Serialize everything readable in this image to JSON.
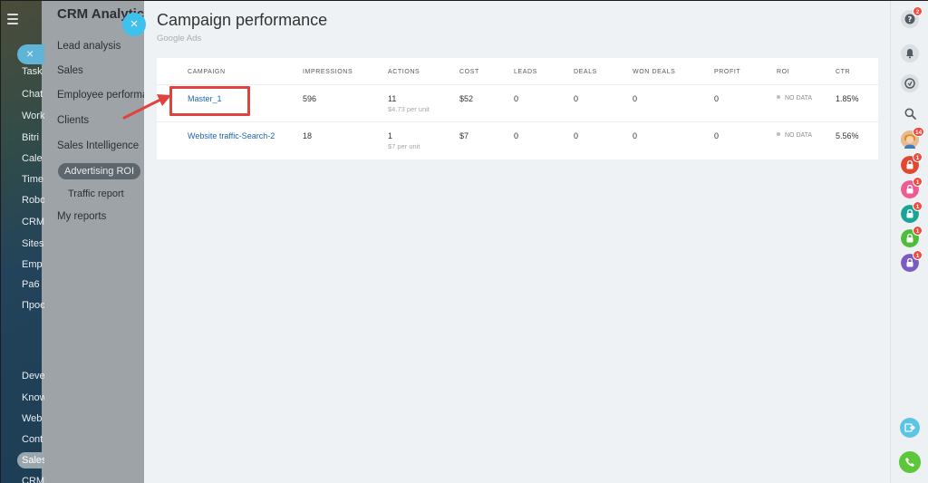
{
  "left_nav": {
    "items": [
      "Task",
      "Chat",
      "Work",
      "Bitri",
      "Cale",
      "Time",
      "Robo",
      "CRM",
      "Sites",
      "Emp",
      "Pa6",
      "Проє",
      "Deve",
      "Know",
      "Web",
      "Cont",
      "Sales",
      "CRM"
    ]
  },
  "sub_panel": {
    "title": "CRM Analytics",
    "items": [
      "Lead analysis",
      "Sales",
      "Employee performance",
      "Clients",
      "Sales Intelligence",
      "Advertising ROI",
      "Traffic report",
      "My reports"
    ]
  },
  "page": {
    "close_glyph": "×",
    "title": "Campaign performance",
    "subtitle": "Google Ads"
  },
  "table": {
    "headers": [
      "CAMPAIGN",
      "IMPRESSIONS",
      "ACTIONS",
      "COST",
      "LEADS",
      "DEALS",
      "WON DEALS",
      "PROFIT",
      "ROI",
      "CTR"
    ],
    "rows": [
      {
        "campaign": "Master_1",
        "impressions": "596",
        "actions": "11",
        "actions_sub": "$4.73 per unit",
        "cost": "$52",
        "leads": "0",
        "deals": "0",
        "won_deals": "0",
        "profit": "0",
        "roi": "NO DATA",
        "ctr": "1.85%"
      },
      {
        "campaign": "Website traffic-Search-2",
        "impressions": "18",
        "actions": "1",
        "actions_sub": "$7 per unit",
        "cost": "$7",
        "leads": "0",
        "deals": "0",
        "won_deals": "0",
        "profit": "0",
        "roi": "NO DATA",
        "ctr": "5.56%"
      }
    ]
  },
  "right_bar": {
    "help_badge": "2",
    "avatar_badge": "14",
    "lock_badges": [
      "1",
      "1",
      "1",
      "1",
      "1"
    ],
    "lock_colors": [
      "#e2472f",
      "#ee5a92",
      "#19a596",
      "#4dbd3a",
      "#7c5cc2"
    ]
  }
}
